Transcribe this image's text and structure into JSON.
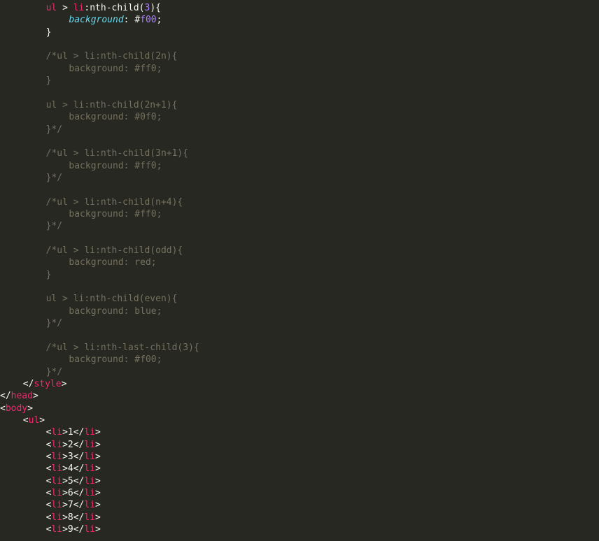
{
  "editor": {
    "language": "html",
    "theme_colors": {
      "background": "#272822",
      "foreground": "#f8f8f2",
      "tag": "#f92672",
      "number": "#ae81ff",
      "property": "#66d9ef",
      "comment": "#75715e"
    },
    "lines": [
      {
        "indent": 2,
        "tokens": [
          {
            "t": "ul",
            "c": "tag"
          },
          {
            "t": " > ",
            "c": "punc"
          },
          {
            "t": "li",
            "c": "tag"
          },
          {
            "t": ":nth-child(",
            "c": "punc"
          },
          {
            "t": "3",
            "c": "num"
          },
          {
            "t": "){",
            "c": "punc"
          }
        ]
      },
      {
        "indent": 3,
        "tokens": [
          {
            "t": "background",
            "c": "prop"
          },
          {
            "t": ": ",
            "c": "punc"
          },
          {
            "t": "#",
            "c": "punc"
          },
          {
            "t": "f00",
            "c": "num"
          },
          {
            "t": ";",
            "c": "punc"
          }
        ]
      },
      {
        "indent": 2,
        "tokens": [
          {
            "t": "}",
            "c": "punc"
          }
        ]
      },
      {
        "indent": 0,
        "tokens": []
      },
      {
        "indent": 2,
        "tokens": [
          {
            "t": "/*ul > li:nth-child(2n){",
            "c": "comment"
          }
        ]
      },
      {
        "indent": 3,
        "tokens": [
          {
            "t": "background: #ff0;",
            "c": "comment"
          }
        ]
      },
      {
        "indent": 2,
        "tokens": [
          {
            "t": "}",
            "c": "comment"
          }
        ]
      },
      {
        "indent": 0,
        "tokens": []
      },
      {
        "indent": 2,
        "tokens": [
          {
            "t": "ul > li:nth-child(2n+1){",
            "c": "comment"
          }
        ]
      },
      {
        "indent": 3,
        "tokens": [
          {
            "t": "background: #0f0;",
            "c": "comment"
          }
        ]
      },
      {
        "indent": 2,
        "tokens": [
          {
            "t": "}*/",
            "c": "comment"
          }
        ]
      },
      {
        "indent": 0,
        "tokens": []
      },
      {
        "indent": 2,
        "tokens": [
          {
            "t": "/*ul > li:nth-child(3n+1){",
            "c": "comment"
          }
        ]
      },
      {
        "indent": 3,
        "tokens": [
          {
            "t": "background: #ff0;",
            "c": "comment"
          }
        ]
      },
      {
        "indent": 2,
        "tokens": [
          {
            "t": "}*/",
            "c": "comment"
          }
        ]
      },
      {
        "indent": 0,
        "tokens": []
      },
      {
        "indent": 2,
        "tokens": [
          {
            "t": "/*ul > li:nth-child(n+4){",
            "c": "comment"
          }
        ]
      },
      {
        "indent": 3,
        "tokens": [
          {
            "t": "background: #ff0;",
            "c": "comment"
          }
        ]
      },
      {
        "indent": 2,
        "tokens": [
          {
            "t": "}*/",
            "c": "comment"
          }
        ]
      },
      {
        "indent": 0,
        "tokens": []
      },
      {
        "indent": 2,
        "tokens": [
          {
            "t": "/*ul > li:nth-child(odd){",
            "c": "comment"
          }
        ]
      },
      {
        "indent": 3,
        "tokens": [
          {
            "t": "background: red;",
            "c": "comment"
          }
        ]
      },
      {
        "indent": 2,
        "tokens": [
          {
            "t": "}",
            "c": "comment"
          }
        ]
      },
      {
        "indent": 0,
        "tokens": []
      },
      {
        "indent": 2,
        "tokens": [
          {
            "t": "ul > li:nth-child(even){",
            "c": "comment"
          }
        ]
      },
      {
        "indent": 3,
        "tokens": [
          {
            "t": "background: blue;",
            "c": "comment"
          }
        ]
      },
      {
        "indent": 2,
        "tokens": [
          {
            "t": "}*/",
            "c": "comment"
          }
        ]
      },
      {
        "indent": 0,
        "tokens": []
      },
      {
        "indent": 2,
        "tokens": [
          {
            "t": "/*ul > li:nth-last-child(3){",
            "c": "comment"
          }
        ]
      },
      {
        "indent": 3,
        "tokens": [
          {
            "t": "background: #f00;",
            "c": "comment"
          }
        ]
      },
      {
        "indent": 2,
        "tokens": [
          {
            "t": "}*/",
            "c": "comment"
          }
        ]
      },
      {
        "indent": 1,
        "tokens": [
          {
            "t": "</",
            "c": "punc"
          },
          {
            "t": "style",
            "c": "tag"
          },
          {
            "t": ">",
            "c": "punc"
          }
        ]
      },
      {
        "indent": 0,
        "tokens": [
          {
            "t": "</",
            "c": "punc"
          },
          {
            "t": "head",
            "c": "tag"
          },
          {
            "t": ">",
            "c": "punc"
          }
        ]
      },
      {
        "indent": 0,
        "tokens": [
          {
            "t": "<",
            "c": "punc"
          },
          {
            "t": "body",
            "c": "tag"
          },
          {
            "t": ">",
            "c": "punc"
          }
        ]
      },
      {
        "indent": 1,
        "tokens": [
          {
            "t": "<",
            "c": "punc"
          },
          {
            "t": "ul",
            "c": "tag"
          },
          {
            "t": ">",
            "c": "punc"
          }
        ]
      },
      {
        "indent": 2,
        "tokens": [
          {
            "t": "<",
            "c": "punc"
          },
          {
            "t": "li",
            "c": "tag"
          },
          {
            "t": ">1</",
            "c": "punc"
          },
          {
            "t": "li",
            "c": "tag"
          },
          {
            "t": ">",
            "c": "punc"
          }
        ]
      },
      {
        "indent": 2,
        "tokens": [
          {
            "t": "<",
            "c": "punc"
          },
          {
            "t": "li",
            "c": "tag"
          },
          {
            "t": ">2</",
            "c": "punc"
          },
          {
            "t": "li",
            "c": "tag"
          },
          {
            "t": ">",
            "c": "punc"
          }
        ]
      },
      {
        "indent": 2,
        "tokens": [
          {
            "t": "<",
            "c": "punc"
          },
          {
            "t": "li",
            "c": "tag"
          },
          {
            "t": ">3</",
            "c": "punc"
          },
          {
            "t": "li",
            "c": "tag"
          },
          {
            "t": ">",
            "c": "punc"
          }
        ]
      },
      {
        "indent": 2,
        "tokens": [
          {
            "t": "<",
            "c": "punc"
          },
          {
            "t": "li",
            "c": "tag"
          },
          {
            "t": ">4</",
            "c": "punc"
          },
          {
            "t": "li",
            "c": "tag"
          },
          {
            "t": ">",
            "c": "punc"
          }
        ]
      },
      {
        "indent": 2,
        "tokens": [
          {
            "t": "<",
            "c": "punc"
          },
          {
            "t": "li",
            "c": "tag"
          },
          {
            "t": ">5</",
            "c": "punc"
          },
          {
            "t": "li",
            "c": "tag"
          },
          {
            "t": ">",
            "c": "punc"
          }
        ]
      },
      {
        "indent": 2,
        "tokens": [
          {
            "t": "<",
            "c": "punc"
          },
          {
            "t": "li",
            "c": "tag"
          },
          {
            "t": ">6</",
            "c": "punc"
          },
          {
            "t": "li",
            "c": "tag"
          },
          {
            "t": ">",
            "c": "punc"
          }
        ]
      },
      {
        "indent": 2,
        "tokens": [
          {
            "t": "<",
            "c": "punc"
          },
          {
            "t": "li",
            "c": "tag"
          },
          {
            "t": ">7</",
            "c": "punc"
          },
          {
            "t": "li",
            "c": "tag"
          },
          {
            "t": ">",
            "c": "punc"
          }
        ]
      },
      {
        "indent": 2,
        "tokens": [
          {
            "t": "<",
            "c": "punc"
          },
          {
            "t": "li",
            "c": "tag"
          },
          {
            "t": ">8</",
            "c": "punc"
          },
          {
            "t": "li",
            "c": "tag"
          },
          {
            "t": ">",
            "c": "punc"
          }
        ]
      },
      {
        "indent": 2,
        "tokens": [
          {
            "t": "<",
            "c": "punc"
          },
          {
            "t": "li",
            "c": "tag"
          },
          {
            "t": ">9</",
            "c": "punc"
          },
          {
            "t": "li",
            "c": "tag"
          },
          {
            "t": ">",
            "c": "punc"
          }
        ]
      }
    ]
  }
}
